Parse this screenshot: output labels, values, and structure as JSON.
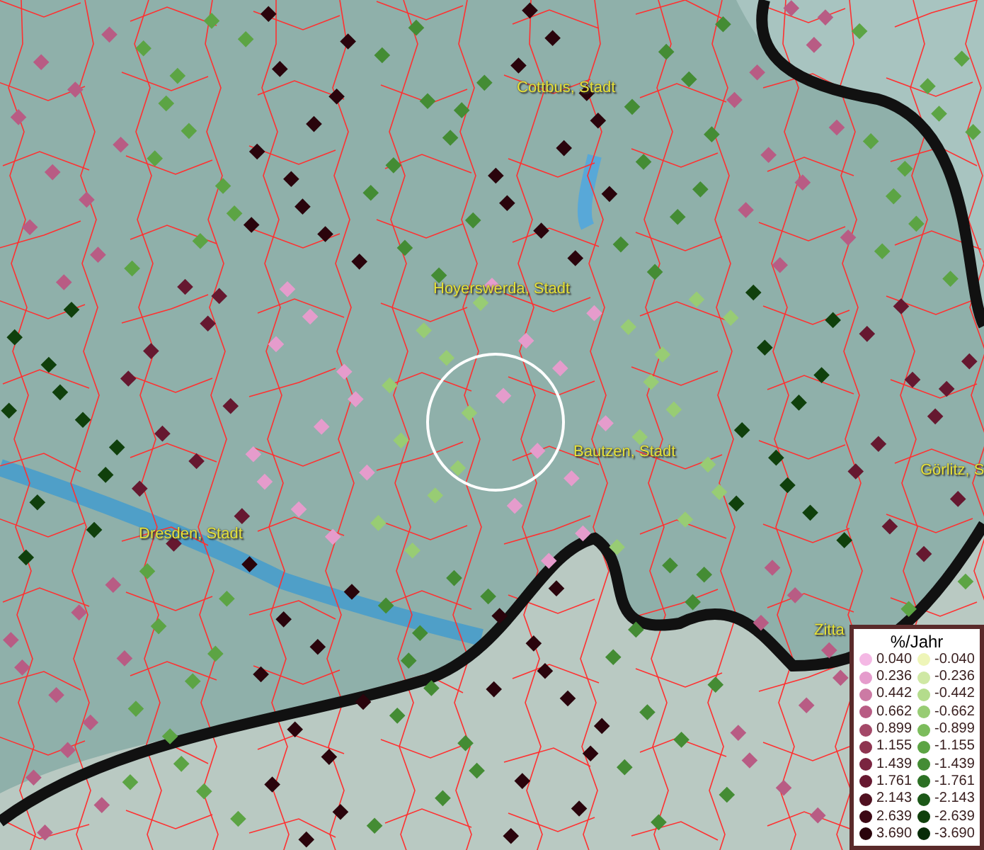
{
  "map": {
    "labels": [
      {
        "text": "Cottbus, Stadt"
      },
      {
        "text": "Hoyerswerda, Stadt"
      },
      {
        "text": "Bautzen, Stadt"
      },
      {
        "text": "Dresden, Stadt"
      },
      {
        "text": "Görlitz, S"
      },
      {
        "text": "Zitta"
      }
    ]
  },
  "legend": {
    "title": "%/Jahr",
    "columns": [
      {
        "entries": [
          {
            "value": "0.040",
            "color": "#f4b8e4"
          },
          {
            "value": "0.236",
            "color": "#e59ccc"
          },
          {
            "value": "0.442",
            "color": "#cc7aa4"
          },
          {
            "value": "0.662",
            "color": "#b85c84"
          },
          {
            "value": "0.899",
            "color": "#a44868"
          },
          {
            "value": "1.155",
            "color": "#8e3450"
          },
          {
            "value": "1.439",
            "color": "#7a2440"
          },
          {
            "value": "1.761",
            "color": "#661830"
          },
          {
            "value": "2.143",
            "color": "#501020"
          },
          {
            "value": "2.639",
            "color": "#3c0814"
          },
          {
            "value": "3.690",
            "color": "#2a040c"
          }
        ]
      },
      {
        "entries": [
          {
            "value": "-0.040",
            "color": "#eef5b8"
          },
          {
            "value": "-0.236",
            "color": "#cfe8a4"
          },
          {
            "value": "-0.442",
            "color": "#b4dc8c"
          },
          {
            "value": "-0.662",
            "color": "#98cc74"
          },
          {
            "value": "-0.899",
            "color": "#7cbc5c"
          },
          {
            "value": "-1.155",
            "color": "#5ca444"
          },
          {
            "value": "-1.439",
            "color": "#448c34"
          },
          {
            "value": "-1.761",
            "color": "#2c7024"
          },
          {
            "value": "-2.143",
            "color": "#1c5818"
          },
          {
            "value": "-2.639",
            "color": "#10400c"
          },
          {
            "value": "-3.690",
            "color": "#082c08"
          }
        ]
      }
    ]
  }
}
